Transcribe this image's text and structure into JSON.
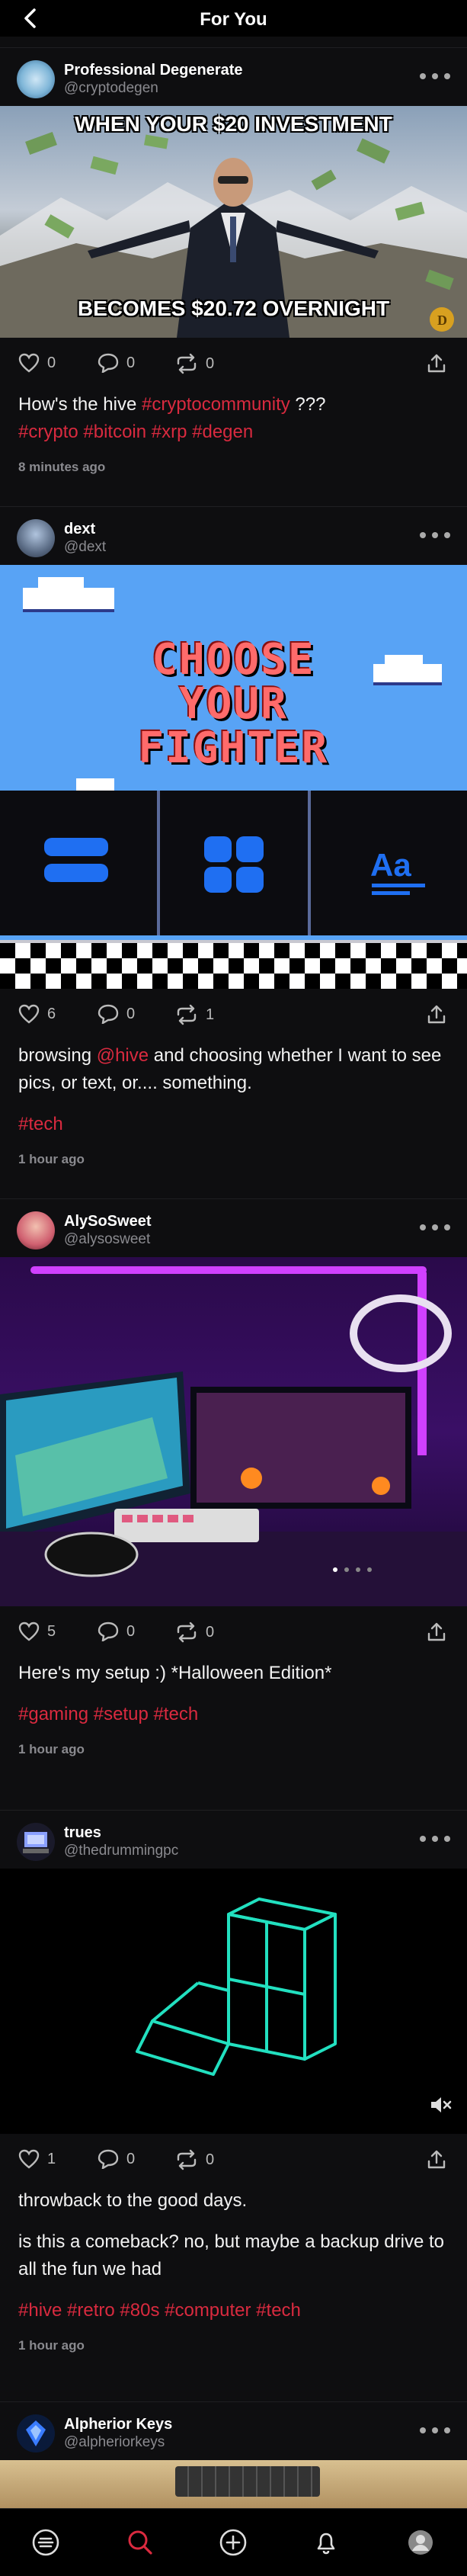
{
  "header": {
    "title": "For You"
  },
  "posts": [
    {
      "name": "Professional Degenerate",
      "handle": "@cryptodegen",
      "meme_top": "WHEN YOUR $20 INVESTMENT",
      "meme_bottom": "BECOMES $20.72 OVERNIGHT",
      "likes": "0",
      "comments": "0",
      "reposts": "0",
      "text_plain": "How's the hive ",
      "text_tag1": "#cryptocommunity",
      "text_after": " ???",
      "tags": "#crypto #bitcoin #xrp #degen",
      "time": "8 minutes ago"
    },
    {
      "name": "dext",
      "handle": "@dext",
      "banner_text1": "CHOOSE",
      "banner_text2": "YOUR",
      "banner_text3": "FIGHTER",
      "likes": "6",
      "comments": "0",
      "reposts": "1",
      "text_a": "browsing ",
      "mention": "@hive",
      "text_b": " and choosing whether I want to see pics, or text, or.... something.",
      "tags": "#tech",
      "time": "1 hour ago"
    },
    {
      "name": "AlySoSweet",
      "handle": "@alysosweet",
      "likes": "5",
      "comments": "0",
      "reposts": "0",
      "text": "Here's my setup :) *Halloween Edition*",
      "tags": "#gaming #setup #tech",
      "time": "1 hour ago"
    },
    {
      "name": "trues",
      "handle": "@thedrummingpc",
      "likes": "1",
      "comments": "0",
      "reposts": "0",
      "text1": "throwback to the good days.",
      "text2": "is this a comeback? no, but maybe a backup drive to all the fun we had",
      "tags": "#hive #retro #80s #computer #tech",
      "time": "1 hour ago"
    },
    {
      "name": "Alpherior Keys",
      "handle": "@alpheriorkeys"
    }
  ],
  "colors": {
    "accent": "#d92a3f",
    "background": "#0e0e10",
    "muted": "#8a8a8f",
    "panel_blue": "#58a3f5",
    "icon_blue": "#1f6ff2"
  },
  "icons": [
    "back-arrow-icon",
    "more-icon",
    "heart-icon",
    "comment-icon",
    "repost-icon",
    "share-icon",
    "mute-icon",
    "home-icon",
    "search-icon",
    "create-icon",
    "bell-icon",
    "profile-icon"
  ]
}
